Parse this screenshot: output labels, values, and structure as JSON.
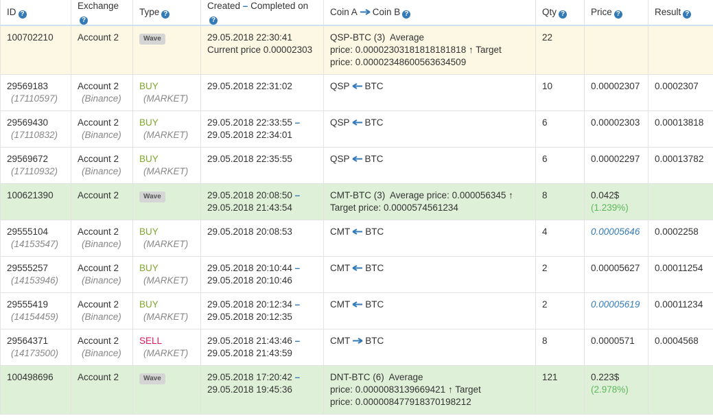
{
  "headers": {
    "id": "ID",
    "exchange": "Exchange",
    "type": "Type",
    "created": "Created",
    "completed": "Completed on",
    "coin_a": "Coin A",
    "coin_b": "Coin B",
    "qty": "Qty",
    "price": "Price",
    "result": "Result"
  },
  "rows": [
    {
      "id": "100702210",
      "exchange": "Account 2",
      "type": "Wave",
      "date1": "29.05.2018 22:30:41",
      "date2_prefix": "Current price ",
      "date2": "0.00002303",
      "pair": "QSP-BTC (3)",
      "avg_label": "Average",
      "avg_price_label": "price:",
      "avg_price": "0.00002303181818181818",
      "target_label": "Target",
      "target_price_label": "price:",
      "target_price": "0.00002348600563634509",
      "qty": "22",
      "price": "",
      "result": ""
    },
    {
      "id": "29569183",
      "sub_id": "(17110597)",
      "exchange": "Account 2",
      "sub_exchange": "(Binance)",
      "type": "BUY",
      "sub_type": "(MARKET)",
      "date1": "29.05.2018 22:31:02",
      "coin_a": "QSP",
      "coin_b": "BTC",
      "qty": "10",
      "price": "0.00002307",
      "result": "0.0002307"
    },
    {
      "id": "29569430",
      "sub_id": "(17110832)",
      "exchange": "Account 2",
      "sub_exchange": "(Binance)",
      "type": "BUY",
      "sub_type": "(MARKET)",
      "date1": "29.05.2018 22:33:55",
      "date2": "29.05.2018 22:34:01",
      "coin_a": "QSP",
      "coin_b": "BTC",
      "qty": "6",
      "price": "0.00002303",
      "result": "0.00013818"
    },
    {
      "id": "29569672",
      "sub_id": "(17110932)",
      "exchange": "Account 2",
      "sub_exchange": "(Binance)",
      "type": "BUY",
      "sub_type": "(MARKET)",
      "date1": "29.05.2018 22:35:55",
      "coin_a": "QSP",
      "coin_b": "BTC",
      "qty": "6",
      "price": "0.00002297",
      "result": "0.00013782"
    },
    {
      "id": "100621390",
      "exchange": "Account 2",
      "type": "Wave",
      "date1": "29.05.2018 20:08:50",
      "date2": "29.05.2018 21:43:54",
      "pair": "CMT-BTC (3)",
      "avg_text": "Average price: 0.000056345",
      "target_text": "Target price: 0.0000574561234",
      "qty": "8",
      "price": "0.042$",
      "pct": "(1.239%)"
    },
    {
      "id": "29555104",
      "sub_id": "(14153547)",
      "exchange": "Account 2",
      "sub_exchange": "(Binance)",
      "type": "BUY",
      "sub_type": "(MARKET)",
      "date1": "29.05.2018 20:08:53",
      "coin_a": "CMT",
      "coin_b": "BTC",
      "qty": "4",
      "price": "0.00005646",
      "result": "0.0002258"
    },
    {
      "id": "29555257",
      "sub_id": "(14153946)",
      "exchange": "Account 2",
      "sub_exchange": "(Binance)",
      "type": "BUY",
      "sub_type": "(MARKET)",
      "date1": "29.05.2018 20:10:44",
      "date2": "29.05.2018 20:10:46",
      "coin_a": "CMT",
      "coin_b": "BTC",
      "qty": "2",
      "price": "0.00005627",
      "result": "0.00011254"
    },
    {
      "id": "29555419",
      "sub_id": "(14154459)",
      "exchange": "Account 2",
      "sub_exchange": "(Binance)",
      "type": "BUY",
      "sub_type": "(MARKET)",
      "date1": "29.05.2018 20:12:34",
      "date2": "29.05.2018 20:12:35",
      "coin_a": "CMT",
      "coin_b": "BTC",
      "qty": "2",
      "price": "0.00005619",
      "result": "0.00011234"
    },
    {
      "id": "29564371",
      "sub_id": "(14173500)",
      "exchange": "Account 2",
      "sub_exchange": "(Binance)",
      "type": "SELL",
      "sub_type": "(MARKET)",
      "date1": "29.05.2018 21:43:46",
      "date2": "29.05.2018 21:43:59",
      "coin_a": "CMT",
      "coin_b": "BTC",
      "qty": "8",
      "price": "0.0000571",
      "result": "0.0004568"
    },
    {
      "id": "100498696",
      "exchange": "Account 2",
      "type": "Wave",
      "date1": "29.05.2018 17:20:42",
      "date2": "29.05.2018 19:45:36",
      "pair": "DNT-BTC (6)",
      "avg_label": "Average",
      "avg_price_label": "price:",
      "avg_price": "0.0000083139669421",
      "target_label": "Target",
      "target_price_label": "price:",
      "target_price": "0.000008477918370198212",
      "qty": "121",
      "price": "0.223$",
      "pct": "(2.978%)"
    }
  ],
  "colors": {
    "link_blue": "#337ab7",
    "buy_green": "#7fa82c",
    "sell_pink": "#e0185e",
    "pct_green": "#5cb85c",
    "wave_yellow_bg": "#fcf8e3",
    "wave_green_bg": "#dff0d8"
  }
}
